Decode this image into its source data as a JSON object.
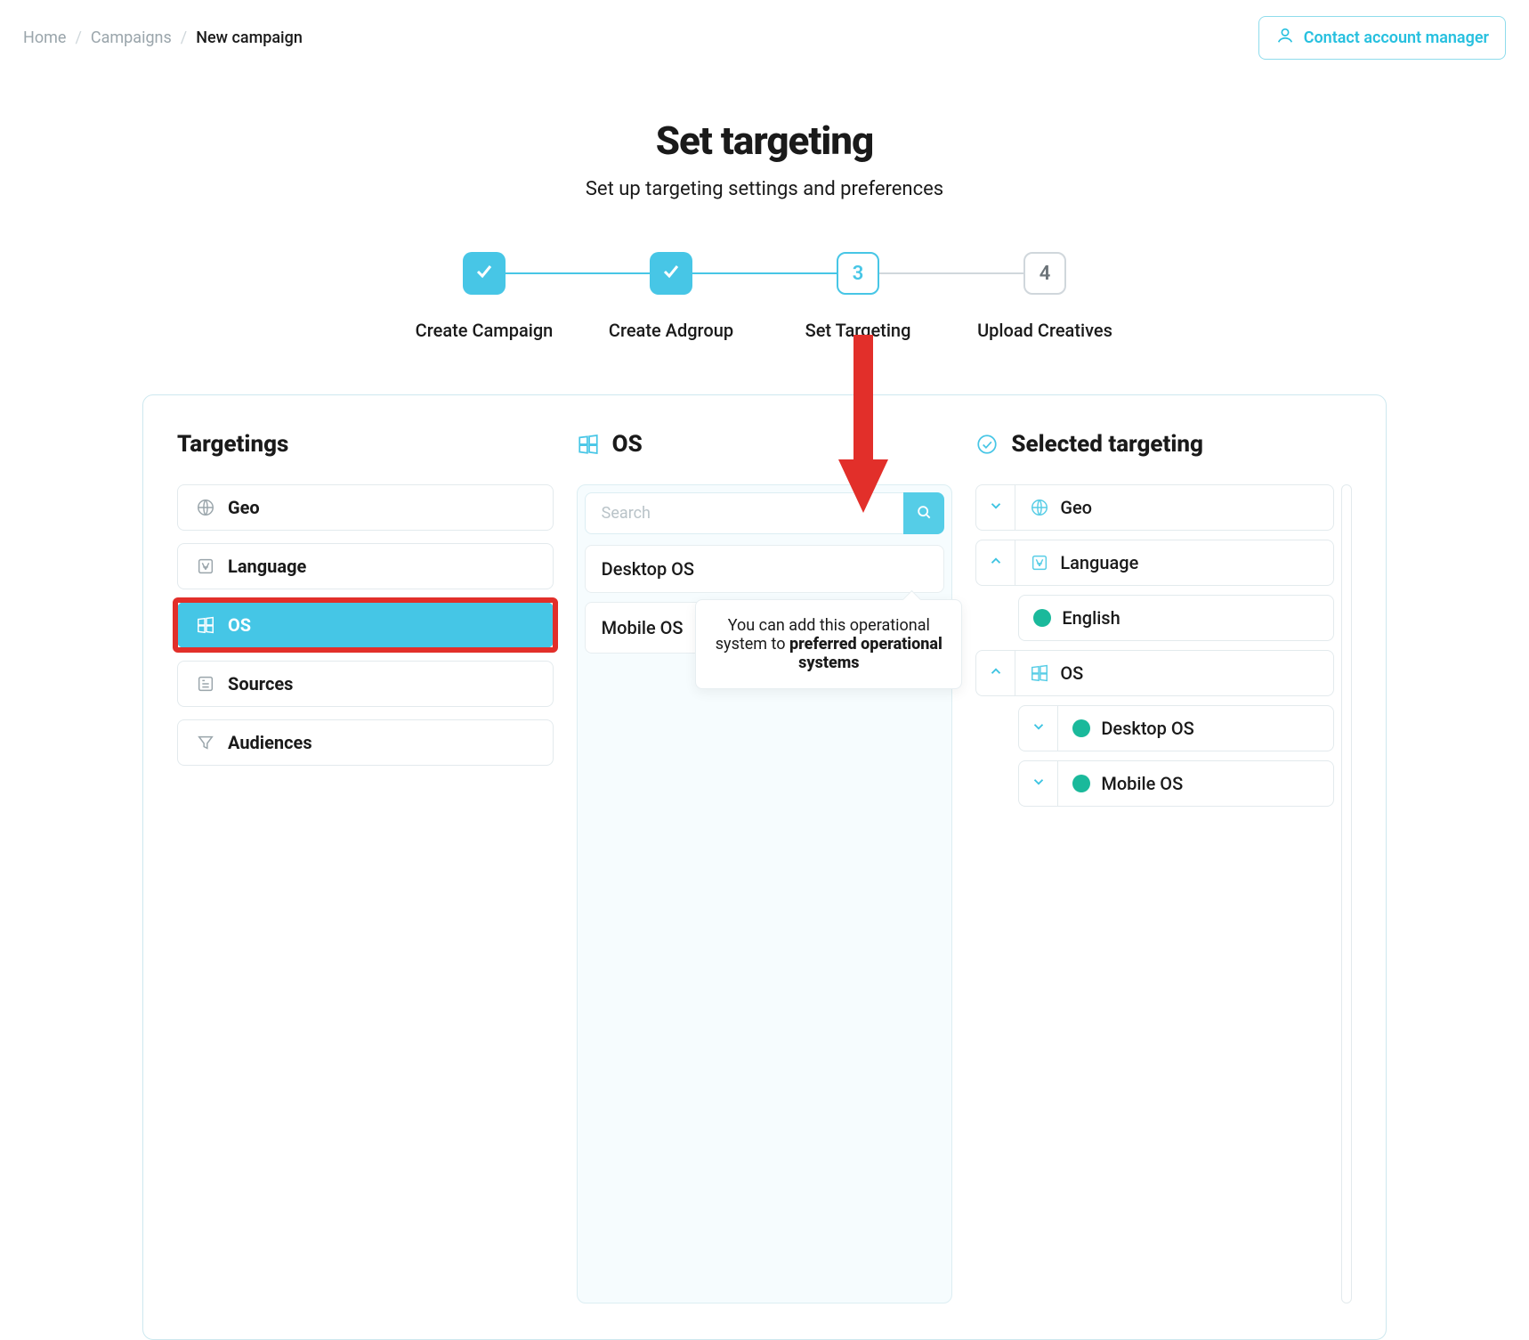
{
  "breadcrumb": {
    "home": "Home",
    "campaigns": "Campaigns",
    "current": "New campaign"
  },
  "contact_label": "Contact account manager",
  "header": {
    "title": "Set targeting",
    "subtitle": "Set up targeting settings and preferences"
  },
  "steps": {
    "s1": "Create Campaign",
    "s2": "Create Adgroup",
    "s3": "Set Targeting",
    "s4": "Upload Creatives",
    "n3": "3",
    "n4": "4"
  },
  "targetings": {
    "title": "Targetings",
    "geo": "Geo",
    "language": "Language",
    "os": "OS",
    "sources": "Sources",
    "audiences": "Audiences"
  },
  "os_column": {
    "title": "OS",
    "search_placeholder": "Search",
    "desktop": "Desktop OS",
    "mobile": "Mobile OS",
    "tooltip_1": "You can add this operational system to",
    "tooltip_2": "preferred operational systems"
  },
  "selected": {
    "title": "Selected targeting",
    "geo": "Geo",
    "language": "Language",
    "english": "English",
    "os": "OS",
    "desktop": "Desktop OS",
    "mobile": "Mobile OS"
  }
}
